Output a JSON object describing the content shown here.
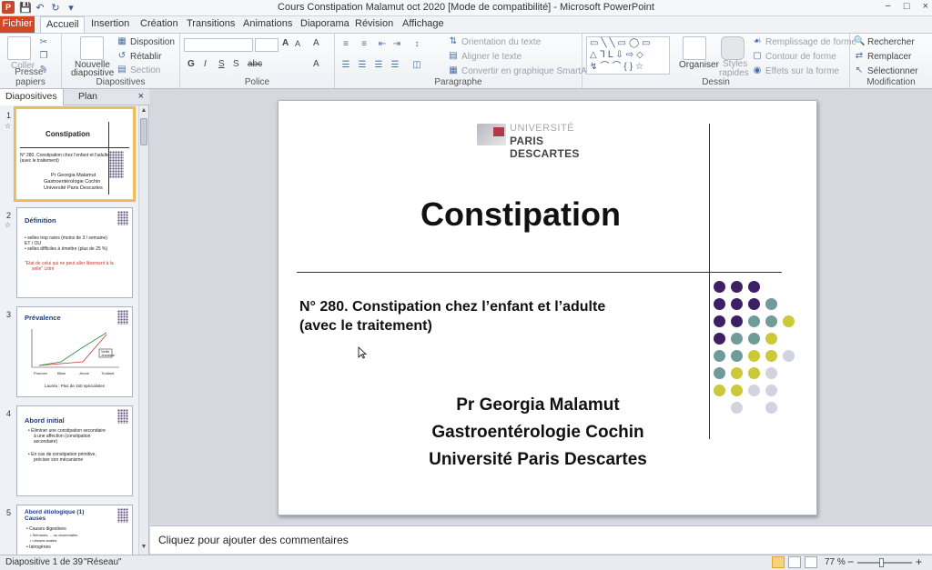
{
  "window": {
    "title": "Cours Constipation Malamut oct 2020 [Mode de compatibilité] - Microsoft PowerPoint",
    "app_icon": "P",
    "qat_icons": [
      "save-icon",
      "undo-icon",
      "redo-icon",
      "customize-icon"
    ],
    "controls": [
      "−",
      "□",
      "×"
    ]
  },
  "ribbon_tabs": [
    "Fichier",
    "Accueil",
    "Insertion",
    "Création",
    "Transitions",
    "Animations",
    "Diaporama",
    "Révision",
    "Affichage"
  ],
  "ribbon": {
    "groups": {
      "clipboard": "Presse-papiers",
      "slides": "Diapositives",
      "font": "Police",
      "paragraph": "Paragraphe",
      "drawing": "Dessin",
      "editing": "Modification"
    },
    "coller": "Coller",
    "nouvelle_diapositive_1": "Nouvelle",
    "nouvelle_diapositive_2": "diapositive",
    "disposition": "Disposition",
    "retablir": "Rétablir",
    "section": "Section",
    "font_style": [
      "G",
      "I",
      "S",
      "S",
      "abc"
    ],
    "font_size_up": "A",
    "font_size_down": "A",
    "clear_format": "A",
    "font_color": "A",
    "orientation_texte": "Orientation du texte",
    "aligner_texte": "Aligner le texte",
    "smartart": "Convertir en graphique SmartArt",
    "organiser": "Organiser",
    "styles_rapides_1": "Styles",
    "styles_rapides_2": "rapides",
    "remplissage": "Remplissage de forme",
    "contour": "Contour de forme",
    "effets": "Effets sur la forme",
    "rechercher": "Rechercher",
    "remplacer": "Remplacer",
    "selectionner": "Sélectionner"
  },
  "left_panel": {
    "tab_slides": "Diapositives",
    "tab_outline": "Plan",
    "close": "×",
    "thumbnails": [
      {
        "num": "1",
        "title": "Constipation",
        "line1": "N° 280. Constipation chez l'enfant et l'adulte",
        "line2": "(avec le traitement)",
        "a1": "Pr Georgia Malamut",
        "a2": "Gastroentérologie Cochin",
        "a3": "Université Paris Descartes"
      },
      {
        "num": "2",
        "title": "Définition",
        "l1": "• selles trop rares (moins de 3 / semaine)",
        "l2": "ET / OU",
        "l3": "• selles difficiles à émettre (plus de 25 %)",
        "q1": "\"Etat de celui qui ne peut aller librement à la",
        "q2": "selle\" Littré"
      },
      {
        "num": "3",
        "title": "Prévalence",
        "caption": "Lauréa : Plus de 150 spécialistes",
        "x": [
          "Pourcen",
          "Bilan",
          "Jeune",
          "Troillard"
        ],
        "legend": [
          "Vieille",
          "Jeunesse"
        ]
      },
      {
        "num": "4",
        "title": "Abord initial",
        "l1": "• Éliminer une constipation secondaire",
        "l2": "à une affection (constipation",
        "l3": "secondaire)",
        "l4": "• En cas de constipation primitive,",
        "l5": "préciser son mécanisme"
      },
      {
        "num": "5",
        "title": "Abord étiologique (1)",
        "title2": "Causes",
        "l1": "• Causes digestives",
        "l2": "• Sténoses, ... ou anorectales",
        "l3": "• Lésions anales",
        "l4": "• Iatrogènes"
      }
    ]
  },
  "slide": {
    "logo_line1": "UNIVERSITÉ",
    "logo_line2": "PARIS DESCARTES",
    "title": "Constipation",
    "subtitle_line1": "N° 280. Constipation chez l’enfant et l’adulte",
    "subtitle_line2": "(avec le traitement)",
    "author_line1": "Pr Georgia Malamut",
    "author_line2": "Gastroentérologie Cochin",
    "author_line3": "Université Paris Descartes",
    "dot_colors": {
      "purple": "#3d1f63",
      "teal": "#6f9b98",
      "yellow": "#c9c93a",
      "gray": "#d2d3df"
    }
  },
  "notes": {
    "placeholder": "Cliquez pour ajouter des commentaires"
  },
  "status": {
    "slide_info": "Diapositive 1 de 39",
    "theme": "\"Réseau\"",
    "zoom": "77 %",
    "zoom_out": "−",
    "zoom_in": "+"
  }
}
